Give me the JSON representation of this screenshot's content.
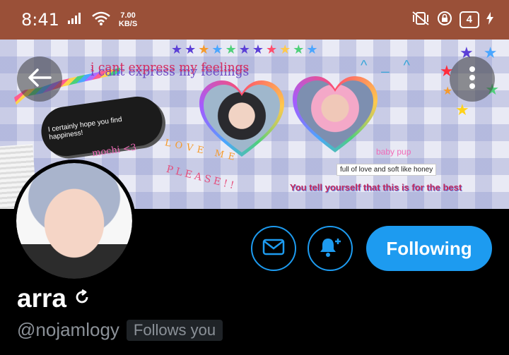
{
  "status_bar": {
    "time": "8:41",
    "net_speed_value": "7.00",
    "net_speed_unit": "KB/S",
    "battery_level": "4"
  },
  "banner": {
    "script_text": "i cant express my feelings",
    "note_text": "I certainly hope you find happiness!",
    "mochi_text": "mochi <3",
    "love_text": "LOVE ME",
    "please_text": "PLEASE!!",
    "baby_pup_text": "baby pup",
    "full_of_love_text": "full of love and soft like honey",
    "tell_yourself_text": "You tell yourself that this is for the best",
    "caret_text": "^_^"
  },
  "profile": {
    "display_name": "arra",
    "handle": "@nojamlogy",
    "follows_you_label": "Follows you"
  },
  "actions": {
    "following_label": "Following"
  },
  "colors": {
    "status_bar_bg": "#9a5038",
    "accent": "#1d9bf0",
    "background": "#000000",
    "muted_text": "#8b9198"
  },
  "icons": {
    "back": "arrow-left-icon",
    "more": "more-vertical-icon",
    "message": "envelope-icon",
    "notify": "bell-plus-icon",
    "name_badge": "refresh-icon"
  }
}
